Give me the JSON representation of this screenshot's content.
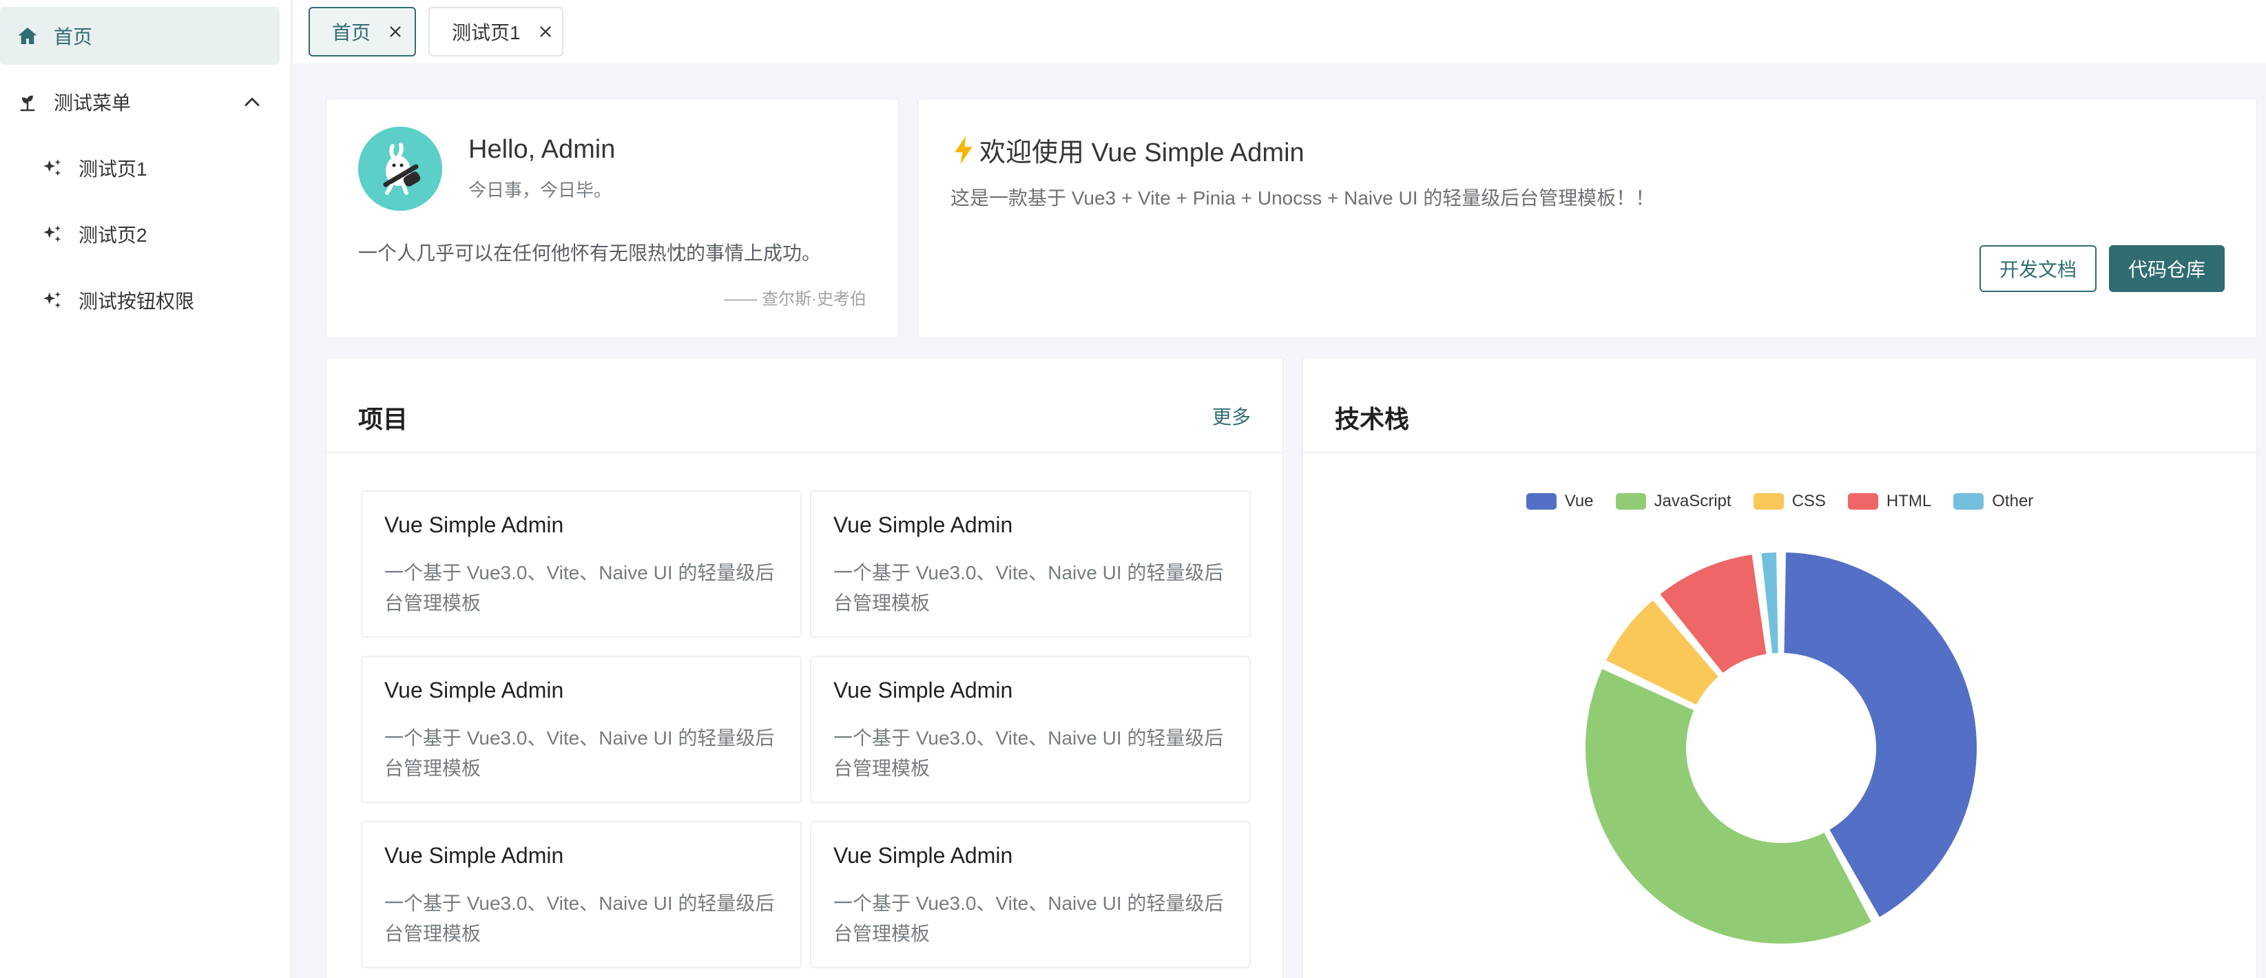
{
  "sidebar": {
    "items": [
      {
        "label": "首页",
        "icon": "home-icon",
        "active": true
      },
      {
        "label": "测试菜单",
        "icon": "plant-icon",
        "expanded": true
      },
      {
        "label": "测试页1",
        "icon": "sparkle-icon"
      },
      {
        "label": "测试页2",
        "icon": "sparkle-icon"
      },
      {
        "label": "测试按钮权限",
        "icon": "sparkle-icon"
      }
    ]
  },
  "tabs": [
    {
      "label": "首页",
      "active": true
    },
    {
      "label": "测试页1",
      "active": false
    }
  ],
  "user_card": {
    "greeting": "Hello, Admin",
    "subtitle": "今日事，今日毕。",
    "quote": "一个人几乎可以在任何他怀有无限热忱的事情上成功。",
    "quote_author": "—— 查尔斯·史考伯"
  },
  "welcome_card": {
    "title": "欢迎使用 Vue Simple Admin",
    "description": "这是一款基于 Vue3 + Vite + Pinia + Unocss + Naive UI 的轻量级后台管理模板！！",
    "docs_button": "开发文档",
    "repo_button": "代码仓库"
  },
  "projects_card": {
    "title": "项目",
    "more_link": "更多",
    "items": [
      {
        "title": "Vue Simple Admin",
        "desc": "一个基于 Vue3.0、Vite、Naive UI 的轻量级后台管理模板"
      },
      {
        "title": "Vue Simple Admin",
        "desc": "一个基于 Vue3.0、Vite、Naive UI 的轻量级后台管理模板"
      },
      {
        "title": "Vue Simple Admin",
        "desc": "一个基于 Vue3.0、Vite、Naive UI 的轻量级后台管理模板"
      },
      {
        "title": "Vue Simple Admin",
        "desc": "一个基于 Vue3.0、Vite、Naive UI 的轻量级后台管理模板"
      },
      {
        "title": "Vue Simple Admin",
        "desc": "一个基于 Vue3.0、Vite、Naive UI 的轻量级后台管理模板"
      },
      {
        "title": "Vue Simple Admin",
        "desc": "一个基于 Vue3.0、Vite、Naive UI 的轻量级后台管理模板"
      }
    ]
  },
  "tech_card": {
    "title": "技术栈"
  },
  "colors": {
    "primary": "#316c72",
    "vue": "#5470c6",
    "javascript": "#91cc75",
    "css": "#fac858",
    "html": "#ee6666",
    "other": "#73c0de"
  },
  "chart_data": {
    "type": "pie",
    "donut": true,
    "categories": [
      "Vue",
      "JavaScript",
      "CSS",
      "HTML",
      "Other"
    ],
    "values": [
      42,
      40,
      7,
      9,
      2
    ],
    "legend": "top-center"
  }
}
